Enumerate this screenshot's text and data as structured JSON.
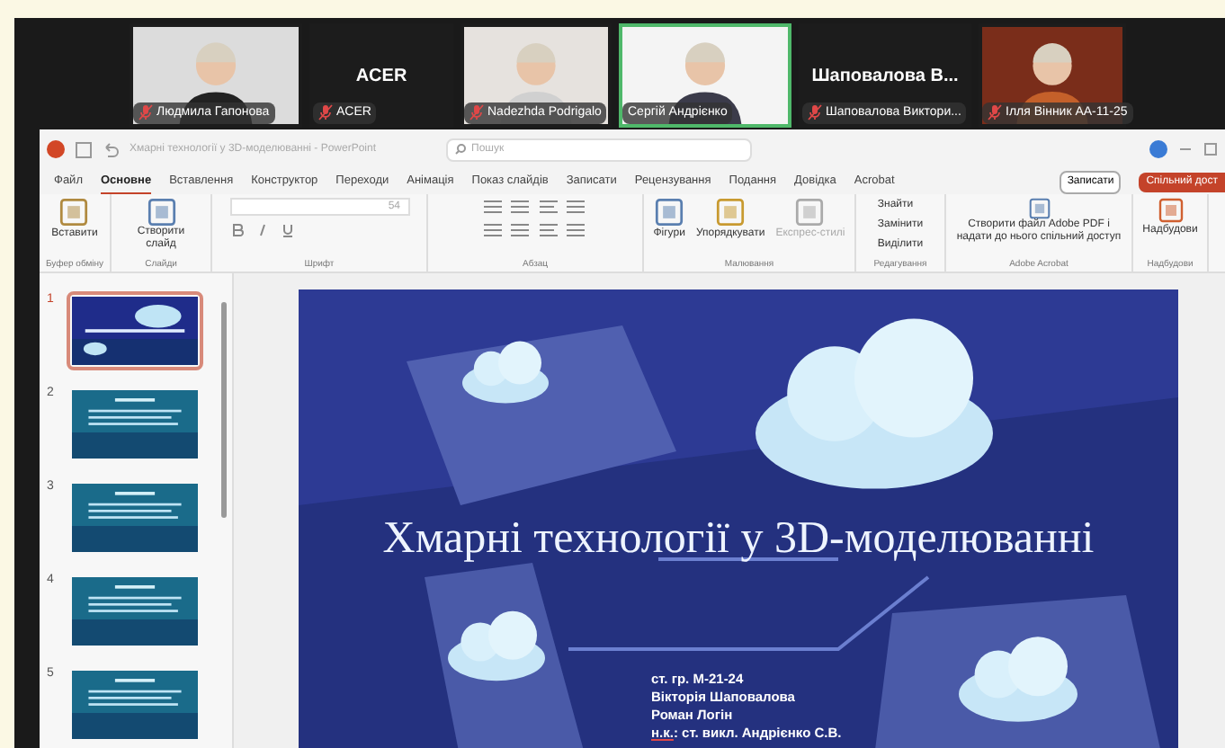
{
  "participants": [
    {
      "kind": "video",
      "name": "Людмила Гапонова",
      "muted": true,
      "speaking": false
    },
    {
      "kind": "name",
      "title": "ACER",
      "name": "ACER",
      "muted": true,
      "speaking": false
    },
    {
      "kind": "video",
      "name": "Nadezhda Podrigalo",
      "muted": true,
      "speaking": false
    },
    {
      "kind": "video",
      "name": "Сергій Андрієнко",
      "muted": false,
      "speaking": true
    },
    {
      "kind": "name",
      "title": "Шаповалова  В...",
      "name": "Шаповалова Виктори...",
      "muted": true,
      "speaking": false
    },
    {
      "kind": "video",
      "name": "Ілля Вінник АА-11-25",
      "muted": true,
      "speaking": false
    }
  ],
  "window": {
    "title": "Хмарні технології у 3D-моделюванні  -  PowerPoint",
    "search_placeholder": "Пошук"
  },
  "tabs": [
    {
      "label": "Файл",
      "selected": false
    },
    {
      "label": "Основне",
      "selected": true
    },
    {
      "label": "Вставлення",
      "selected": false
    },
    {
      "label": "Конструктор",
      "selected": false
    },
    {
      "label": "Переходи",
      "selected": false
    },
    {
      "label": "Анімація",
      "selected": false
    },
    {
      "label": "Показ слайдів",
      "selected": false
    },
    {
      "label": "Записати",
      "selected": false
    },
    {
      "label": "Рецензування",
      "selected": false
    },
    {
      "label": "Подання",
      "selected": false
    },
    {
      "label": "Довідка",
      "selected": false
    },
    {
      "label": "Acrobat",
      "selected": false
    }
  ],
  "record_button": "Записати",
  "share_button": "Спільний дост",
  "ribbon": {
    "paste": "Вставити",
    "new_slide": "Створити слайд",
    "font_size": "54",
    "shapes": "Фігури",
    "arrange": "Упорядкувати",
    "quick_styles": "Експрес-стилі",
    "find": "Знайти",
    "replace": "Замінити",
    "select": "Виділити",
    "acrobat": "Створити файл Adobe PDF і надати до нього спільний доступ",
    "addins": "Надбудови",
    "groups": [
      "Буфер обміну",
      "Слайди",
      "Шрифт",
      "Абзац",
      "Малювання",
      "Редагування",
      "Adobe Acrobat",
      "Надбудови"
    ]
  },
  "slides": [
    {
      "number": "1",
      "selected": true
    },
    {
      "number": "2",
      "selected": false
    },
    {
      "number": "3",
      "selected": false
    },
    {
      "number": "4",
      "selected": false
    },
    {
      "number": "5",
      "selected": false
    }
  ],
  "slide": {
    "title": "Хмарні технології у 3D-моделюванні",
    "lines": [
      "ст. гр. М-21-24",
      "Вікторія Шаповалова",
      "Роман Логін"
    ],
    "advisor_prefix": "н.к.",
    "advisor": ": ст. викл. Андрієнко С.В."
  }
}
